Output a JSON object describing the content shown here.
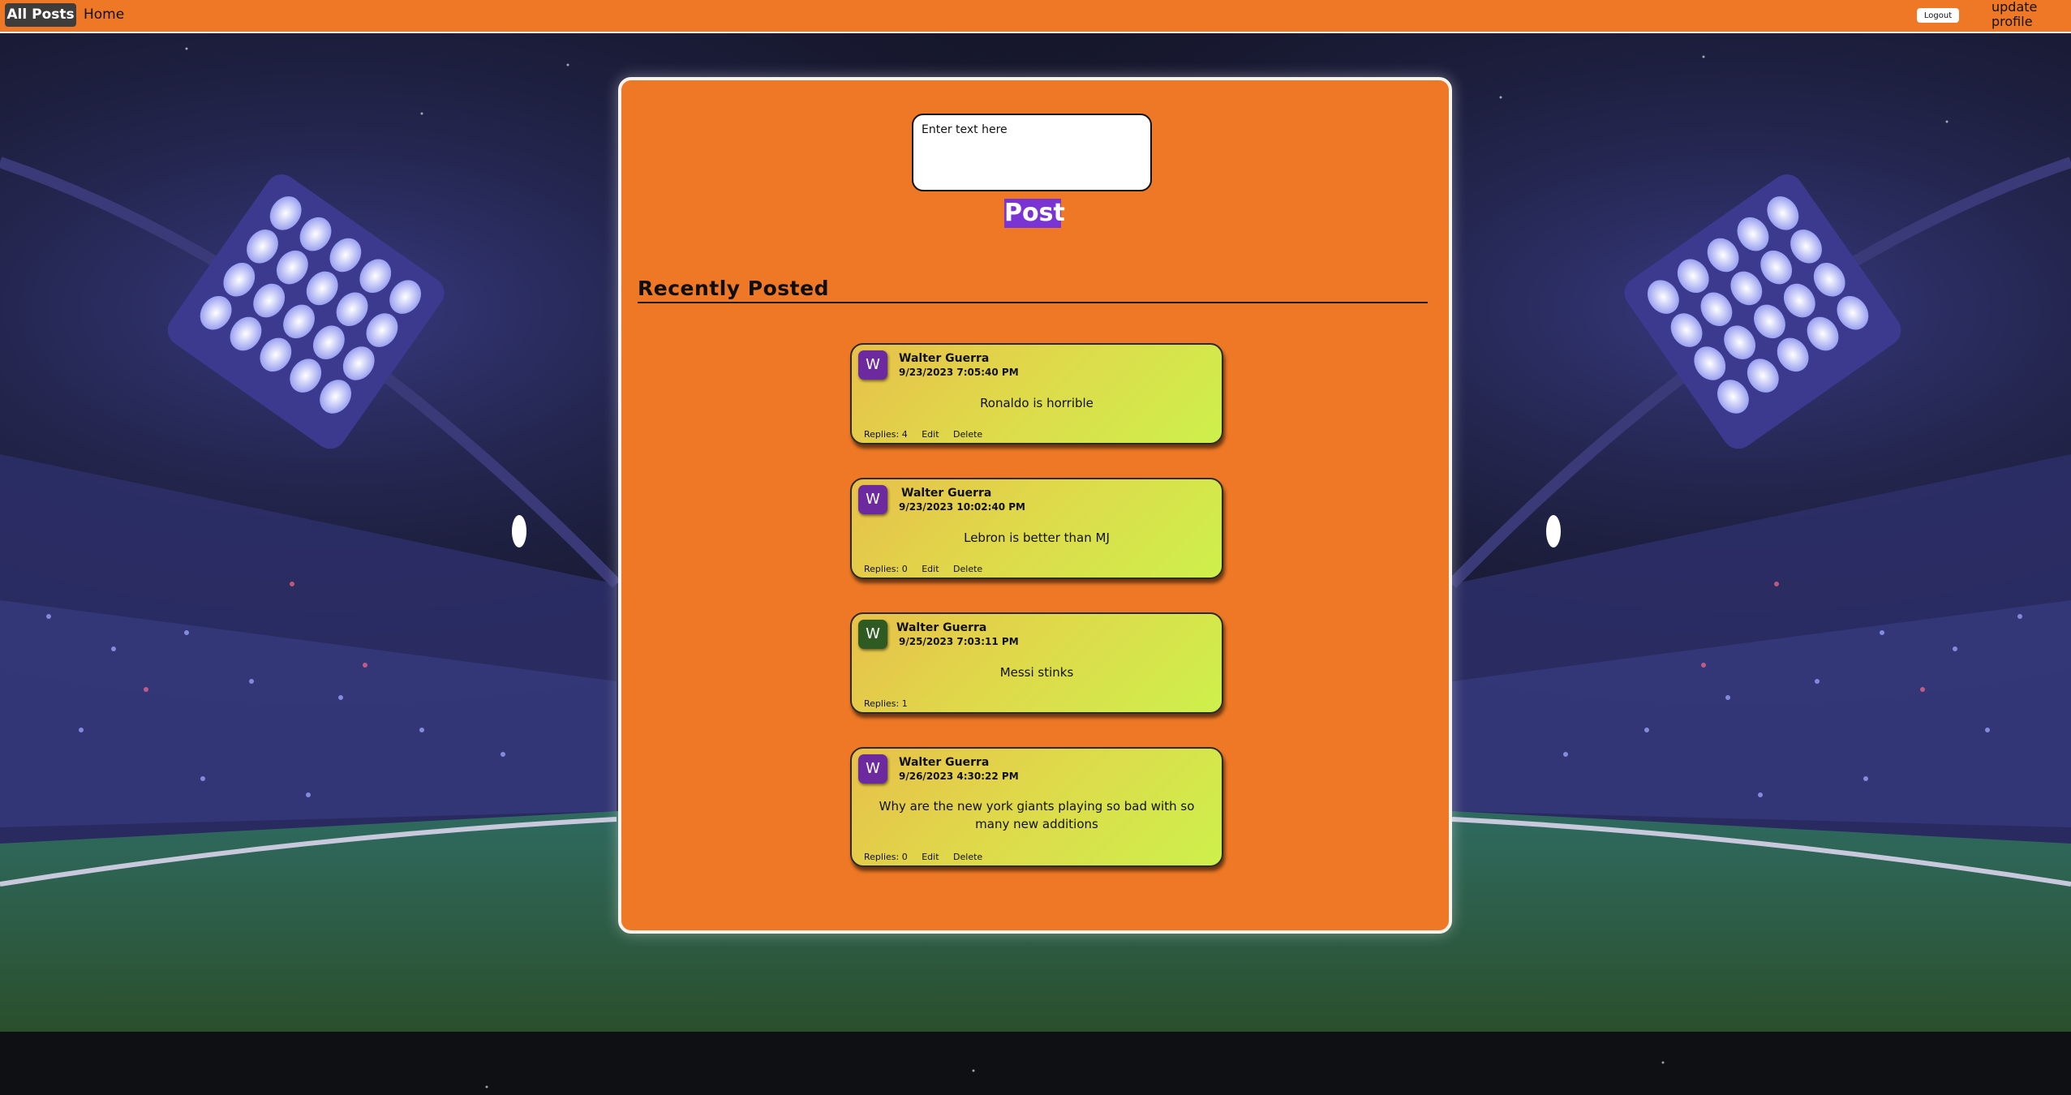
{
  "nav": {
    "all_posts": "All Posts",
    "home": "Home",
    "logout": "Logout",
    "update_profile": "update profile"
  },
  "composer": {
    "placeholder": "Enter text here",
    "post_button": "Post"
  },
  "feed": {
    "heading": "Recently Posted",
    "posts": [
      {
        "initial": "W",
        "author": "Walter Guerra",
        "timestamp": "9/23/2023 7:05:40 PM",
        "text": "Ronaldo is horrible",
        "replies": "Replies: 4",
        "edit": "Edit",
        "delete": "Delete",
        "avatar_color": "#6d2a9e"
      },
      {
        "initial": "W",
        "author": "Walter Guerra",
        "timestamp": "9/23/2023 10:02:40 PM",
        "text": "Lebron is better than MJ",
        "replies": "Replies: 0",
        "edit": "Edit",
        "delete": "Delete",
        "avatar_color": "#6d2a9e"
      },
      {
        "initial": "W",
        "author": "Walter Guerra",
        "timestamp": "9/25/2023 7:03:11 PM",
        "text": "Messi stinks",
        "replies": "Replies: 1",
        "avatar_color": "#2f5a22"
      },
      {
        "initial": "W",
        "author": "Walter Guerra",
        "timestamp": "9/26/2023 4:30:22 PM",
        "text": "Why are the new york giants playing so bad with so many new additions",
        "replies": "Replies: 0",
        "edit": "Edit",
        "delete": "Delete",
        "avatar_color": "#6d2a9e"
      }
    ]
  },
  "colors": {
    "accent_orange": "#ee7825",
    "post_button": "#7a34d4",
    "active_nav": "#3f3d3b"
  }
}
